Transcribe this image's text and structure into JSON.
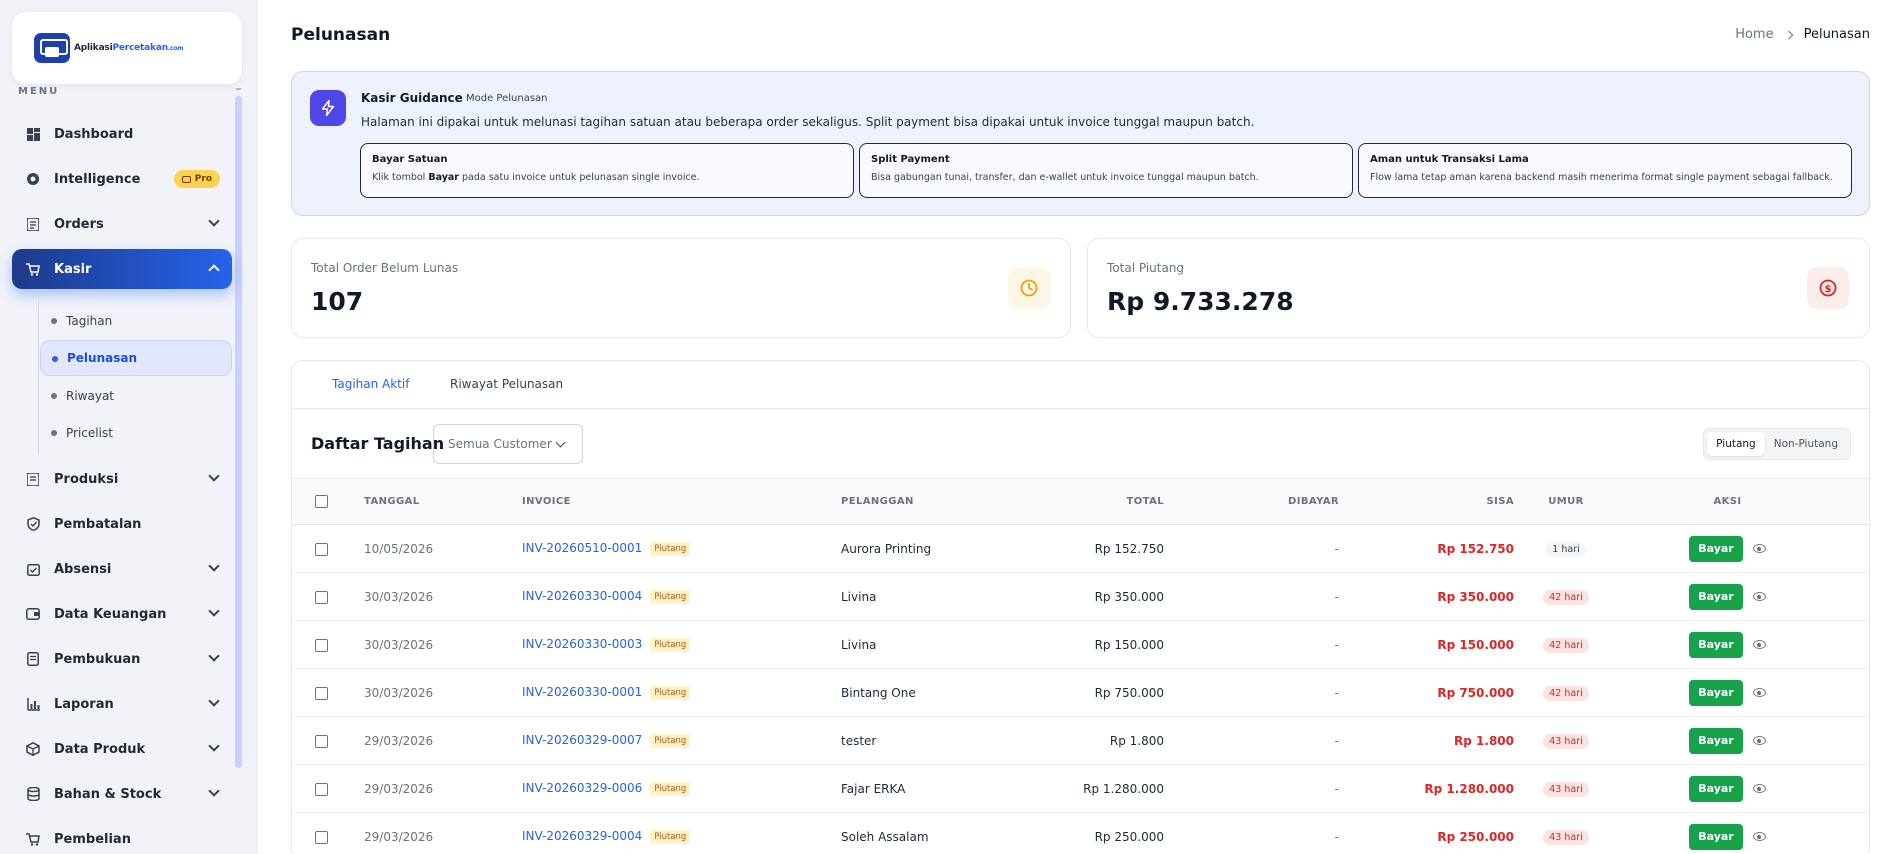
{
  "brand": {
    "name_prefix": "Aplikasi",
    "name_highlight": "Percetakan",
    "name_suffix": ".com"
  },
  "sidebar": {
    "menu_label": "MENU",
    "items": [
      {
        "label": "Dashboard",
        "icon": "dashboard-icon"
      },
      {
        "label": "Intelligence",
        "icon": "intelligence-icon",
        "badge": "Pro"
      },
      {
        "label": "Orders",
        "icon": "orders-icon"
      },
      {
        "label": "Kasir",
        "icon": "cart-icon"
      },
      {
        "label": "Produksi",
        "icon": "produksi-icon"
      },
      {
        "label": "Pembatalan",
        "icon": "shield-icon"
      },
      {
        "label": "Absensi",
        "icon": "calendar-check-icon"
      },
      {
        "label": "Data Keuangan",
        "icon": "wallet-icon"
      },
      {
        "label": "Pembukuan",
        "icon": "book-icon"
      },
      {
        "label": "Laporan",
        "icon": "bar-chart-icon"
      },
      {
        "label": "Data Produk",
        "icon": "box-icon"
      },
      {
        "label": "Bahan & Stock",
        "icon": "database-icon"
      },
      {
        "label": "Pembelian",
        "icon": "cart-icon"
      }
    ],
    "kasir_sub": [
      "Tagihan",
      "Pelunasan",
      "Riwayat",
      "Pricelist"
    ]
  },
  "header": {
    "title": "Pelunasan",
    "breadcrumb_home": "Home",
    "breadcrumb_current": "Pelunasan"
  },
  "guidance": {
    "title": "Kasir Guidance",
    "mode": "Mode Pelunasan",
    "description": "Halaman ini dipakai untuk melunasi tagihan satuan atau beberapa order sekaligus. Split payment bisa dipakai untuk invoice tunggal maupun batch.",
    "cards": [
      {
        "title": "Bayar Satuan",
        "pre": "Klik tombol ",
        "bold": "Bayar",
        "post": " pada satu invoice untuk pelunasan single invoice."
      },
      {
        "title": "Split Payment",
        "text": "Bisa gabungan tunai, transfer, dan e-wallet untuk invoice tunggal maupun batch."
      },
      {
        "title": "Aman untuk Transaksi Lama",
        "text": "Flow lama tetap aman karena backend masih menerima format single payment sebagai fallback."
      }
    ]
  },
  "stats": {
    "unpaid_label": "Total Order Belum Lunas",
    "unpaid_value": "107",
    "receivable_label": "Total Piutang",
    "receivable_value": "Rp 9.733.278"
  },
  "tabs": [
    "Tagihan Aktif",
    "Riwayat Pelunasan"
  ],
  "list": {
    "title": "Daftar Tagihan",
    "customer_filter": "Semua Customer",
    "segments": [
      "Piutang",
      "Non-Piutang"
    ]
  },
  "table": {
    "columns": [
      "TANGGAL",
      "INVOICE",
      "PELANGGAN",
      "TOTAL",
      "DIBAYAR",
      "SISA",
      "UMUR",
      "AKSI"
    ],
    "pay_label": "Bayar",
    "rows": [
      {
        "date": "10/05/2026",
        "invoice": "INV-20260510-0001",
        "tag": "Piutang",
        "customer": "Aurora Printing",
        "total": "Rp 152.750",
        "paid": "-",
        "remaining": "Rp 152.750",
        "age": "1 hari",
        "overdue": false
      },
      {
        "date": "30/03/2026",
        "invoice": "INV-20260330-0004",
        "tag": "Piutang",
        "customer": "Livina",
        "total": "Rp 350.000",
        "paid": "-",
        "remaining": "Rp 350.000",
        "age": "42 hari",
        "overdue": true
      },
      {
        "date": "30/03/2026",
        "invoice": "INV-20260330-0003",
        "tag": "Piutang",
        "customer": "Livina",
        "total": "Rp 150.000",
        "paid": "-",
        "remaining": "Rp 150.000",
        "age": "42 hari",
        "overdue": true
      },
      {
        "date": "30/03/2026",
        "invoice": "INV-20260330-0001",
        "tag": "Piutang",
        "customer": "Bintang One",
        "total": "Rp 750.000",
        "paid": "-",
        "remaining": "Rp 750.000",
        "age": "42 hari",
        "overdue": true
      },
      {
        "date": "29/03/2026",
        "invoice": "INV-20260329-0007",
        "tag": "Piutang",
        "customer": "tester",
        "total": "Rp 1.800",
        "paid": "-",
        "remaining": "Rp 1.800",
        "age": "43 hari",
        "overdue": true
      },
      {
        "date": "29/03/2026",
        "invoice": "INV-20260329-0006",
        "tag": "Piutang",
        "customer": "Fajar ERKA",
        "total": "Rp 1.280.000",
        "paid": "-",
        "remaining": "Rp 1.280.000",
        "age": "43 hari",
        "overdue": true
      },
      {
        "date": "29/03/2026",
        "invoice": "INV-20260329-0004",
        "tag": "Piutang",
        "customer": "Soleh Assalam",
        "total": "Rp 250.000",
        "paid": "-",
        "remaining": "Rp 250.000",
        "age": "43 hari",
        "overdue": true
      }
    ]
  },
  "colors": {
    "accent": "#2563eb",
    "success": "#16a34a",
    "danger": "#dc2626",
    "warning": "#f59e0b"
  }
}
